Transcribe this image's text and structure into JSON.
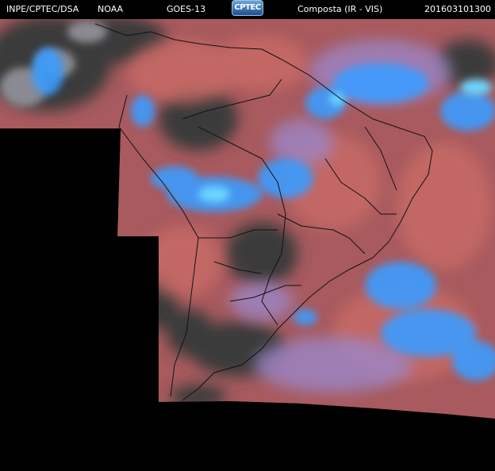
{
  "header": {
    "source": "INPE/CPTEC/DSA",
    "agency": "NOAA",
    "satellite": "GOES-13",
    "logo_text": "CPTEC",
    "product": "Composta (IR - VIS)",
    "timestamp": "201603101300"
  },
  "palette": {
    "background": "#000000",
    "clear_land": "#3a3a3a",
    "warm_cloud": "#c0605a",
    "mid_cloud": "#9a7ab8",
    "cold_cloud": "#3aa0ff",
    "high_cloud": "#5fd0ff",
    "borders": "#000000"
  }
}
